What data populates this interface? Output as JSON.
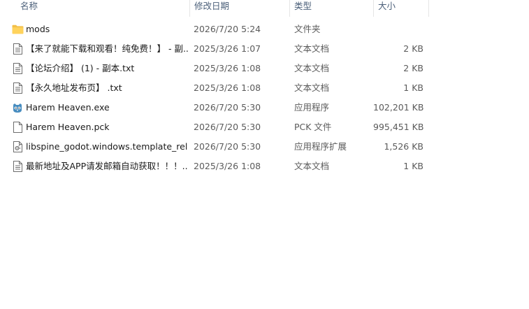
{
  "columns": {
    "name": "名称",
    "date": "修改日期",
    "type": "类型",
    "size": "大小"
  },
  "files": [
    {
      "name": "mods",
      "date": "2026/7/20 5:24",
      "type": "文件夹",
      "size": "",
      "icon": "folder-icon"
    },
    {
      "name": "【来了就能下载和观看！纯免费！】 - 副...",
      "date": "2025/3/26 1:07",
      "type": "文本文档",
      "size": "2 KB",
      "icon": "text-document-icon"
    },
    {
      "name": "【论坛介绍】 (1) - 副本.txt",
      "date": "2025/3/26 1:08",
      "type": "文本文档",
      "size": "2 KB",
      "icon": "text-document-icon"
    },
    {
      "name": "【永久地址发布页】 .txt",
      "date": "2025/3/26 1:08",
      "type": "文本文档",
      "size": "1 KB",
      "icon": "text-document-icon"
    },
    {
      "name": "Harem Heaven.exe",
      "date": "2026/7/20 5:30",
      "type": "应用程序",
      "size": "102,201 KB",
      "icon": "godot-app-icon"
    },
    {
      "name": "Harem Heaven.pck",
      "date": "2026/7/20 5:30",
      "type": "PCK 文件",
      "size": "995,451 KB",
      "icon": "blank-file-icon"
    },
    {
      "name": "libspine_godot.windows.template_rel...",
      "date": "2026/7/20 5:30",
      "type": "应用程序扩展",
      "size": "1,526 KB",
      "icon": "dll-file-icon"
    },
    {
      "name": "最新地址及APP请发邮箱自动获取！！！...",
      "date": "2025/3/26 1:08",
      "type": "文本文档",
      "size": "1 KB",
      "icon": "text-document-icon"
    }
  ]
}
